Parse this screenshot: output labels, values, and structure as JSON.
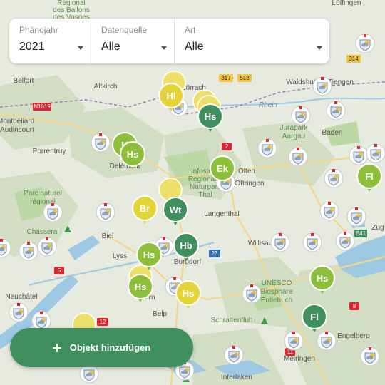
{
  "filters": {
    "year": {
      "label": "Phänojahr",
      "value": "2021"
    },
    "source": {
      "label": "Datenquelle",
      "value": "Alle"
    },
    "type": {
      "label": "Art",
      "value": "Alle"
    }
  },
  "add_button": {
    "label": "Objekt hinzufügen"
  },
  "colors": {
    "green_dark": "#3f8f5f",
    "green_light": "#8dbf3a",
    "yellow": "#e3d43a",
    "station": "#ffffff",
    "route_red": "#d7262e",
    "water": "#9ec9e3",
    "forest": "#bcd8a5"
  },
  "places": [
    "Löffingen",
    "Régional",
    "des Ballons",
    "des Vosges",
    "Belfort",
    "Altkirch",
    "Lörrach",
    "Waldshut",
    "Tiengen",
    "Montbéliard",
    "Audincourt",
    "Porrentruy",
    "Delémont",
    "Rhein",
    "Jurapark",
    "Aargau",
    "Baden",
    "Infostelle",
    "Regionaler",
    "Naturpark",
    "Thal",
    "Olten",
    "Oftringen",
    "Langenthal",
    "Parc naturel",
    "régional",
    "Chasseral",
    "Biel",
    "Lyss",
    "Burgdorf",
    "Willisau",
    "Zug",
    "Neuchâtel",
    "Bern",
    "Belp",
    "UNESCO",
    "Biosphäre",
    "Entlebuch",
    "Schrattenfluh",
    "Engelberg",
    "Interlaken",
    "Meiringen"
  ],
  "road_labels": [
    "317",
    "518",
    "314",
    "N1019",
    "2",
    "23",
    "12",
    "E41",
    "5",
    "8",
    "8",
    "11",
    "Hs"
  ],
  "markers": [
    {
      "code": "Hl",
      "kind": "yellow"
    },
    {
      "code": "Hs",
      "kind": "green_dark"
    },
    {
      "code": "H",
      "kind": "green_light"
    },
    {
      "code": "Hs",
      "kind": "green_light"
    },
    {
      "code": "Ek",
      "kind": "green_light"
    },
    {
      "code": "Fl",
      "kind": "green_light"
    },
    {
      "code": "Br",
      "kind": "yellow"
    },
    {
      "code": "Wt",
      "kind": "green_dark"
    },
    {
      "code": "Hb",
      "kind": "green_dark"
    },
    {
      "code": "Hs",
      "kind": "green_light"
    },
    {
      "code": "Hs",
      "kind": "green_light"
    },
    {
      "code": "Hs",
      "kind": "yellow"
    },
    {
      "code": "Hs",
      "kind": "green_light"
    },
    {
      "code": "Fl",
      "kind": "green_dark"
    }
  ]
}
